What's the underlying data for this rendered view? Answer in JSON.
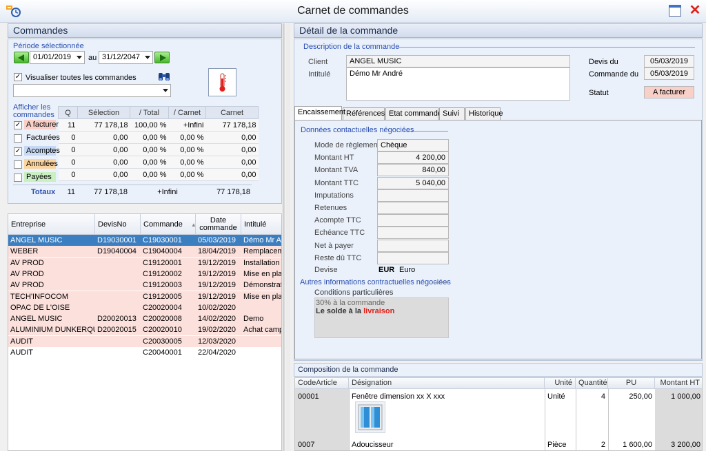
{
  "window": {
    "title": "Carnet de commandes"
  },
  "left": {
    "title": "Commandes",
    "period_label": "Période sélectionnée",
    "date_from": "01/01/2019",
    "date_sep": "au",
    "date_to": "31/12/2047",
    "show_all_label": "Visualiser toutes les commandes",
    "show_all_checked": true,
    "afficher_label": "Afficher les commandes",
    "stats_headers": [
      "Q",
      "Sélection",
      "/ Total",
      "/ Carnet",
      "Carnet"
    ],
    "stats_rows": [
      {
        "label": "A facturer",
        "checked": true,
        "color": "#f9d0c8",
        "q": "11",
        "sel": "77 178,18",
        "total": "100,00 %",
        "carnet_pct": "+Infini",
        "carnet": "77 178,18"
      },
      {
        "label": "Facturées",
        "checked": false,
        "color": "",
        "q": "0",
        "sel": "0,00",
        "total": "0,00 %",
        "carnet_pct": "0,00 %",
        "carnet": "0,00"
      },
      {
        "label": "Acomptes",
        "checked": true,
        "color": "#c6d9f4",
        "q": "0",
        "sel": "0,00",
        "total": "0,00 %",
        "carnet_pct": "0,00 %",
        "carnet": "0,00"
      },
      {
        "label": "Annulées",
        "checked": false,
        "color": "#fbd49e",
        "q": "0",
        "sel": "0,00",
        "total": "0,00 %",
        "carnet_pct": "0,00 %",
        "carnet": "0,00"
      },
      {
        "label": "Payées",
        "checked": false,
        "color": "#c9efc3",
        "q": "0",
        "sel": "0,00",
        "total": "0,00 %",
        "carnet_pct": "0,00 %",
        "carnet": "0,00"
      }
    ],
    "totals": {
      "label": "Totaux",
      "q": "11",
      "sel": "77 178,18",
      "carnet_pct": "+Infini",
      "carnet": "77 178,18"
    },
    "orders_headers": [
      "Entreprise",
      "DevisNo",
      "Commande",
      "Date commande",
      "Intitulé"
    ],
    "orders": [
      {
        "entreprise": "ANGEL MUSIC",
        "devis": "D19030001",
        "commande": "C19030001",
        "date": "05/03/2019",
        "intitule": "Démo Mr André",
        "state": "selected"
      },
      {
        "entreprise": "WEBER",
        "devis": "D19040004",
        "commande": "C19040004",
        "date": "18/04/2019",
        "intitule": "Remplacement",
        "state": "pink"
      },
      {
        "entreprise": "AV PROD",
        "devis": "",
        "commande": "C19120001",
        "date": "19/12/2019",
        "intitule": "Installation de",
        "state": "pink"
      },
      {
        "entreprise": "AV PROD",
        "devis": "",
        "commande": "C19120002",
        "date": "19/12/2019",
        "intitule": "Mise en place",
        "state": "pink"
      },
      {
        "entreprise": "AV PROD",
        "devis": "",
        "commande": "C19120003",
        "date": "19/12/2019",
        "intitule": "Démonstration",
        "state": "pink"
      },
      {
        "entreprise": "TECH'INFOCOM",
        "devis": "",
        "commande": "C19120005",
        "date": "19/12/2019",
        "intitule": "Mise en place",
        "state": "pink"
      },
      {
        "entreprise": "OPAC DE L'OISE",
        "devis": "",
        "commande": "C20020004",
        "date": "10/02/2020",
        "intitule": "",
        "state": "pink"
      },
      {
        "entreprise": "ANGEL MUSIC",
        "devis": "D20020013",
        "commande": "C20020008",
        "date": "14/02/2020",
        "intitule": "Demo",
        "state": "pink"
      },
      {
        "entreprise": "ALUMINIUM DUNKERQUE",
        "devis": "D20020015",
        "commande": "C20020010",
        "date": "19/02/2020",
        "intitule": "Achat campi",
        "state": "pink"
      },
      {
        "entreprise": "AUDIT",
        "devis": "",
        "commande": "C20030005",
        "date": "12/03/2020",
        "intitule": "",
        "state": "pink"
      },
      {
        "entreprise": "AUDIT",
        "devis": "",
        "commande": "C20040001",
        "date": "22/04/2020",
        "intitule": "",
        "state": "white"
      }
    ]
  },
  "right": {
    "title": "Détail de la commande",
    "desc_title": "Description de la commande",
    "client_label": "Client",
    "client_value": "ANGEL MUSIC",
    "intitule_label": "Intitulé",
    "intitule_value": "Démo Mr André",
    "devis_du_label": "Devis du",
    "devis_du_value": "05/03/2019",
    "commande_du_label": "Commande du",
    "commande_du_value": "05/03/2019",
    "statut_label": "Statut",
    "statut_value": "A facturer",
    "tabs": [
      "Encaissement",
      "Références",
      "Etat commande",
      "Suivi",
      "Historique"
    ],
    "donnees_title": "Données contactuelles négociées",
    "fields": [
      {
        "label": "Mode de règlement",
        "value": "Chèque",
        "align": "left"
      },
      {
        "label": "Montant HT",
        "value": "4 200,00",
        "align": "right"
      },
      {
        "label": "Montant TVA",
        "value": "840,00",
        "align": "right"
      },
      {
        "label": "Montant TTC",
        "value": "5 040,00",
        "align": "right"
      },
      {
        "label": "Imputations",
        "value": "",
        "align": "right"
      },
      {
        "label": "Retenues",
        "value": "",
        "align": "right"
      },
      {
        "label": "Acompte TTC",
        "value": "",
        "align": "right"
      },
      {
        "label": "Echéance TTC",
        "value": "",
        "align": "right"
      },
      {
        "label": "Net à payer",
        "value": "",
        "align": "right"
      },
      {
        "label": "Reste dû TTC",
        "value": "",
        "align": "right"
      }
    ],
    "devise_label": "Devise",
    "devise_code": "EUR",
    "devise_name": "Euro",
    "autres_title": "Autres informations contractuelles négociées",
    "conditions_label": "Conditions particulières",
    "conditions_line1": "30% à la commande",
    "conditions_line2a": "Le solde à la ",
    "conditions_line2b": "livraison",
    "composition_title": "Composition de la commande",
    "comp_headers": [
      "CodeArticle",
      "Désignation",
      "Unité",
      "Quantité",
      "PU",
      "Montant HT"
    ],
    "comp_rows": [
      {
        "code": "00001",
        "designation": "Fenêtre dimension xx X xxx",
        "unite": "Unité",
        "quantite": "4",
        "pu": "250,00",
        "montant": "1 000,00"
      },
      {
        "code": "0007",
        "designation": "Adoucisseur",
        "unite": "Pièce",
        "quantite": "2",
        "pu": "1 600,00",
        "montant": "3 200,00"
      }
    ]
  }
}
